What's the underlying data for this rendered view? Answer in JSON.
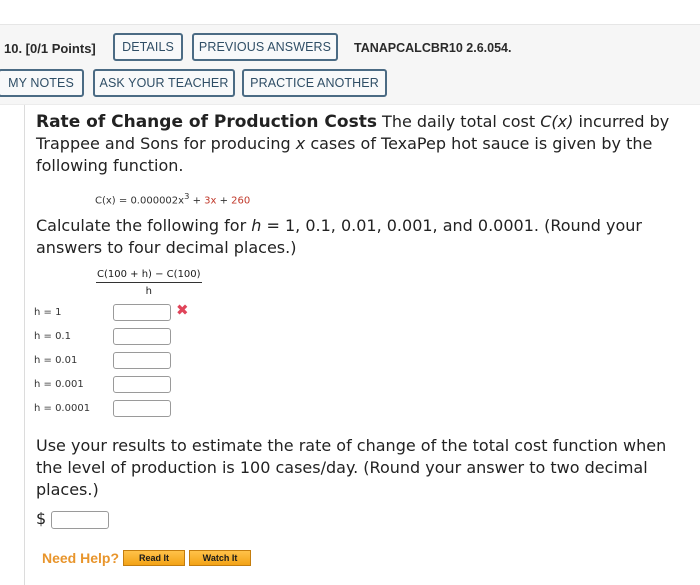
{
  "header": {
    "question_label": "10.  [0/1 Points]",
    "buttons": {
      "details": "DETAILS",
      "previous_answers": "PREVIOUS ANSWERS",
      "my_notes": "MY NOTES",
      "ask_teacher": "ASK YOUR TEACHER",
      "practice_another": "PRACTICE ANOTHER"
    },
    "problem_code": "TANAPCALCBR10 2.6.054."
  },
  "problem": {
    "title": "Rate of Change of Production Costs",
    "intro_1": " The daily total cost ",
    "intro_var": "C(x)",
    "intro_2": " incurred by Trappee and Sons for producing ",
    "intro_x": "x",
    "intro_3": " cases of TexaPep hot sauce is given by the following function.",
    "formula": {
      "lhs": "C(x) = 0.000002x",
      "exp": "3",
      "plus1": " + ",
      "term2": "3x",
      "plus2": " + ",
      "term3": "260"
    },
    "instruction_1": "Calculate the following for ",
    "instruction_h": "h",
    "instruction_2": " = 1, 0.1, 0.01, 0.001, and 0.0001. (Round your answers to four decimal places.)",
    "fraction": {
      "numerator": "C(100 + h) − C(100)",
      "denominator": "h"
    },
    "rows": [
      {
        "label": "h = 1",
        "value": "",
        "status": "incorrect"
      },
      {
        "label": "h = 0.1",
        "value": ""
      },
      {
        "label": "h = 0.01",
        "value": ""
      },
      {
        "label": "h = 0.001",
        "value": ""
      },
      {
        "label": "h = 0.0001",
        "value": ""
      }
    ],
    "incorrect_mark": "✖",
    "estimate_text": "Use your results to estimate the rate of change of the total cost function when the level of production is 100 cases/day. (Round your answer to two decimal places.)",
    "currency": "$",
    "estimate_value": ""
  },
  "help": {
    "label": "Need Help?",
    "read_it": "Read It",
    "watch_it": "Watch It"
  },
  "colors": {
    "button_border": "#4b6b84",
    "incorrect": "#e0445a",
    "help_orange": "#e8952c",
    "formula_red": "#c0392b"
  }
}
